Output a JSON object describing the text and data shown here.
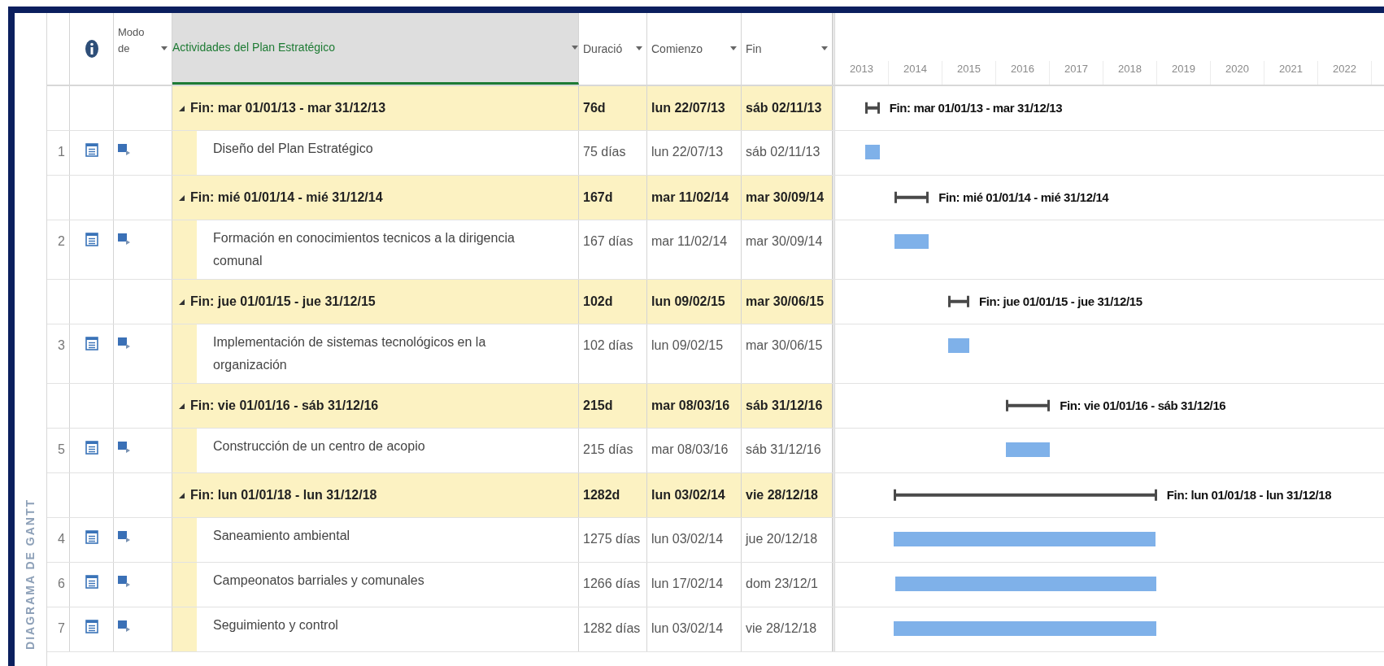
{
  "side_label": "DIAGRAMA DE GANTT",
  "columns": [
    {
      "kind": "id"
    },
    {
      "kind": "info"
    },
    {
      "kind": "text",
      "label": "Modo de",
      "selected": false
    },
    {
      "kind": "text",
      "label": "Actividades del Plan Estratégico",
      "selected": true
    },
    {
      "kind": "text",
      "label": "Duració",
      "selected": false
    },
    {
      "kind": "text",
      "label": "Comienzo",
      "selected": false
    },
    {
      "kind": "text",
      "label": "Fin",
      "selected": false
    }
  ],
  "timescale": [
    "2013",
    "2014",
    "2015",
    "2016",
    "2017",
    "2018",
    "2019",
    "2020",
    "2021",
    "2022"
  ],
  "rows": [
    {
      "kind": "summary",
      "expanded": true,
      "name": "Fin: mar 01/01/13 - mar 31/12/13",
      "duration": "76d",
      "start": "lun 22/07/13",
      "finish": "sáb 02/11/13",
      "gantt_label": "Fin: mar 01/01/13 - mar 31/12/13",
      "children": [
        {
          "kind": "task",
          "id": "1",
          "name": "Diseño del Plan Estratégico",
          "duration": "75 días",
          "start": "lun 22/07/13",
          "finish": "sáb 02/11/13"
        }
      ]
    },
    {
      "kind": "summary",
      "expanded": true,
      "name": "Fin: mié 01/01/14 - mié 31/12/14",
      "duration": "167d",
      "start": "mar 11/02/14",
      "finish": "mar 30/09/14",
      "gantt_label": "Fin: mié 01/01/14 - mié 31/12/14",
      "children": [
        {
          "kind": "task",
          "id": "2",
          "name": "Formación en conocimientos tecnicos a la dirigencia comunal",
          "duration": "167 días",
          "start": "mar 11/02/14",
          "finish": "mar 30/09/14"
        }
      ]
    },
    {
      "kind": "summary",
      "expanded": true,
      "name": "Fin: jue 01/01/15 - jue 31/12/15",
      "duration": "102d",
      "start": "lun 09/02/15",
      "finish": "mar 30/06/15",
      "gantt_label": "Fin: jue 01/01/15 - jue 31/12/15",
      "children": [
        {
          "kind": "task",
          "id": "3",
          "name": "Implementación de sistemas tecnológicos en la organización",
          "duration": "102 días",
          "start": "lun 09/02/15",
          "finish": "mar 30/06/15"
        }
      ]
    },
    {
      "kind": "summary",
      "expanded": true,
      "name": "Fin: vie 01/01/16 - sáb 31/12/16",
      "duration": "215d",
      "start": "mar 08/03/16",
      "finish": "sáb 31/12/16",
      "gantt_label": "Fin: vie 01/01/16 - sáb 31/12/16",
      "children": [
        {
          "kind": "task",
          "id": "5",
          "name": "Construcción de un centro de acopio",
          "duration": "215 días",
          "start": "mar 08/03/16",
          "finish": "sáb 31/12/16"
        }
      ]
    },
    {
      "kind": "summary",
      "expanded": true,
      "name": "Fin: lun 01/01/18 - lun 31/12/18",
      "duration": "1282d",
      "start": "lun 03/02/14",
      "finish": "vie 28/12/18",
      "gantt_label": "Fin: lun 01/01/18 - lun 31/12/18",
      "children": [
        {
          "kind": "task",
          "id": "4",
          "name": "Saneamiento ambiental",
          "duration": "1275 días",
          "start": "lun 03/02/14",
          "finish": "jue 20/12/18"
        },
        {
          "kind": "task",
          "id": "6",
          "name": "Campeonatos barriales y comunales",
          "duration": "1266 días",
          "start": "lun 17/02/14",
          "finish": "dom 23/12/1"
        },
        {
          "kind": "task",
          "id": "7",
          "name": "Seguimiento y control",
          "duration": "1282 días",
          "start": "lun 03/02/14",
          "finish": "vie 28/12/18"
        }
      ]
    }
  ]
}
